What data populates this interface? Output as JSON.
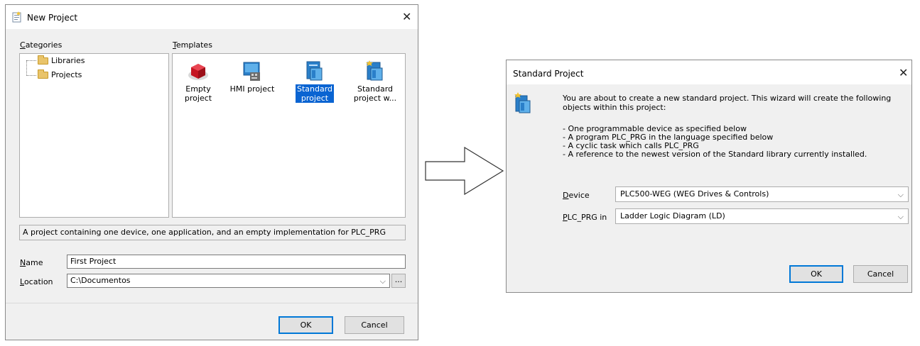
{
  "new_project": {
    "title": "New Project",
    "categories_label": "Categories",
    "categories_accel": "C",
    "categories_rest": "ategories",
    "templates_accel": "T",
    "templates_rest": "emplates",
    "tree": [
      {
        "label": "Libraries"
      },
      {
        "label": "Projects"
      }
    ],
    "templates": [
      {
        "line1": "Empty project",
        "line2": "",
        "icon": "red-cube-icon"
      },
      {
        "line1": "HMI project",
        "line2": "",
        "icon": "hmi-screen-icon"
      },
      {
        "line1": "Standard",
        "line2": "project",
        "icon": "standard-project-icon",
        "selected": true
      },
      {
        "line1": "Standard",
        "line2": "project w...",
        "icon": "standard-project-wizard-icon"
      }
    ],
    "description": "A project containing one device, one application, and an empty implementation for PLC_PRG",
    "name_accel": "N",
    "name_rest": "ame",
    "name_value": "First Project",
    "location_accel": "L",
    "location_rest": "ocation",
    "location_value": "C:\\Documentos",
    "browse_label": "...",
    "ok_label": "OK",
    "cancel_label": "Cancel"
  },
  "standard_project": {
    "title": "Standard Project",
    "intro": "You are about to create a new standard project. This wizard will create the following objects within this project:",
    "bullets": [
      "- One programmable device as specified below",
      "- A program PLC_PRG in the language specified below",
      "- A cyclic task which calls PLC_PRG",
      "- A reference to the newest version of the Standard library currently installed."
    ],
    "device_accel": "D",
    "device_rest": "evice",
    "device_value": "PLC500-WEG (WEG Drives & Controls)",
    "plcprg_accel": "P",
    "plcprg_rest": "LC_PRG in",
    "plcprg_value": "Ladder Logic Diagram (LD)",
    "ok_label": "OK",
    "cancel_label": "Cancel"
  },
  "colors": {
    "selection": "#0a64d2",
    "dialog_bg": "#f0f0f0",
    "default_button_border": "#0078d7"
  }
}
